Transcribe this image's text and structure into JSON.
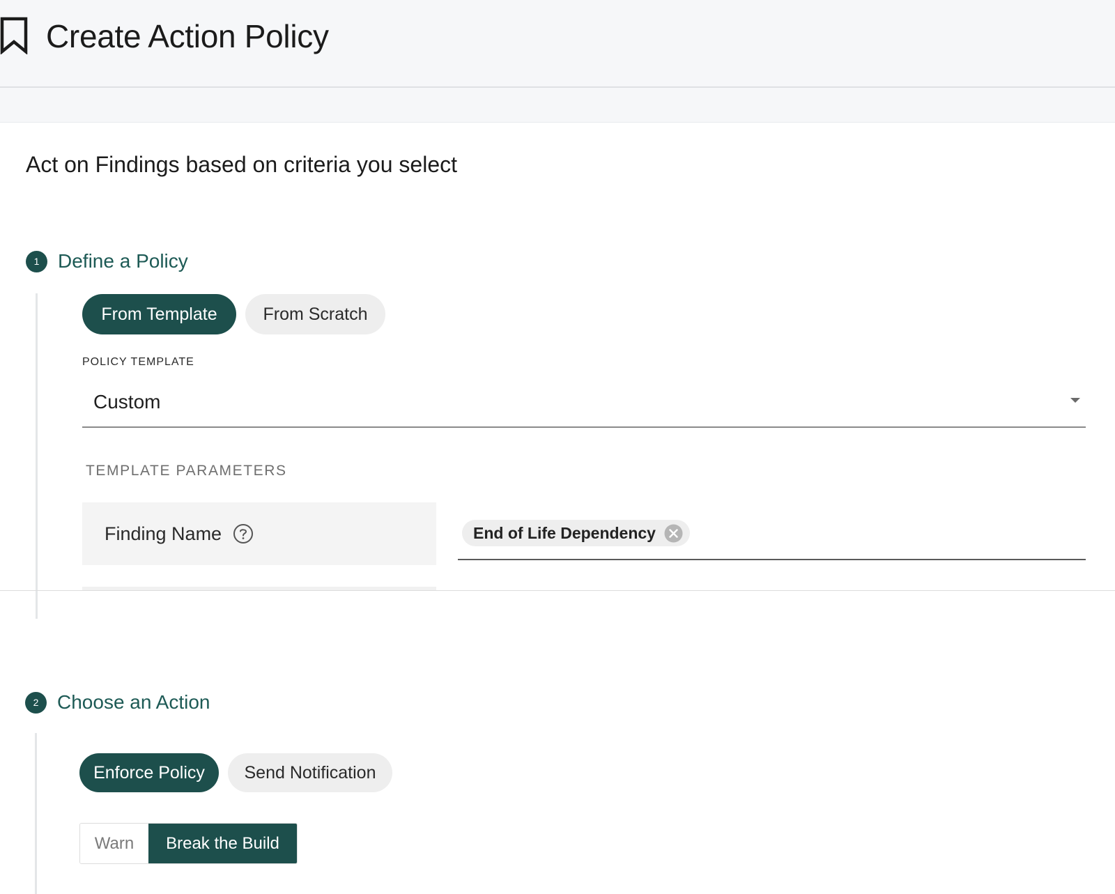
{
  "header": {
    "icon": "bookmark-icon",
    "title": "Create Action Policy"
  },
  "subtitle": "Act on Findings based on criteria you select",
  "step1": {
    "number": "1",
    "title": "Define a Policy",
    "toggle": {
      "options": [
        "From Template",
        "From Scratch"
      ],
      "selected": "From Template"
    },
    "policy_template": {
      "label": "POLICY TEMPLATE",
      "value": "Custom"
    },
    "template_parameters": {
      "label": "TEMPLATE PARAMETERS",
      "params": [
        {
          "name": "Finding Name",
          "icon": "help-circle-icon",
          "chips": [
            "End of Life Dependency"
          ]
        }
      ]
    }
  },
  "step2": {
    "number": "2",
    "title": "Choose an Action",
    "toggle": {
      "options": [
        "Enforce Policy",
        "Send Notification"
      ],
      "selected": "Enforce Policy"
    },
    "mode": {
      "options": [
        "Warn",
        "Break the Build"
      ],
      "selected": "Break the Build"
    }
  },
  "colors": {
    "accent": "#1d4f4c",
    "step_title": "#1d5a55",
    "header_bg": "#f6f7f9"
  }
}
